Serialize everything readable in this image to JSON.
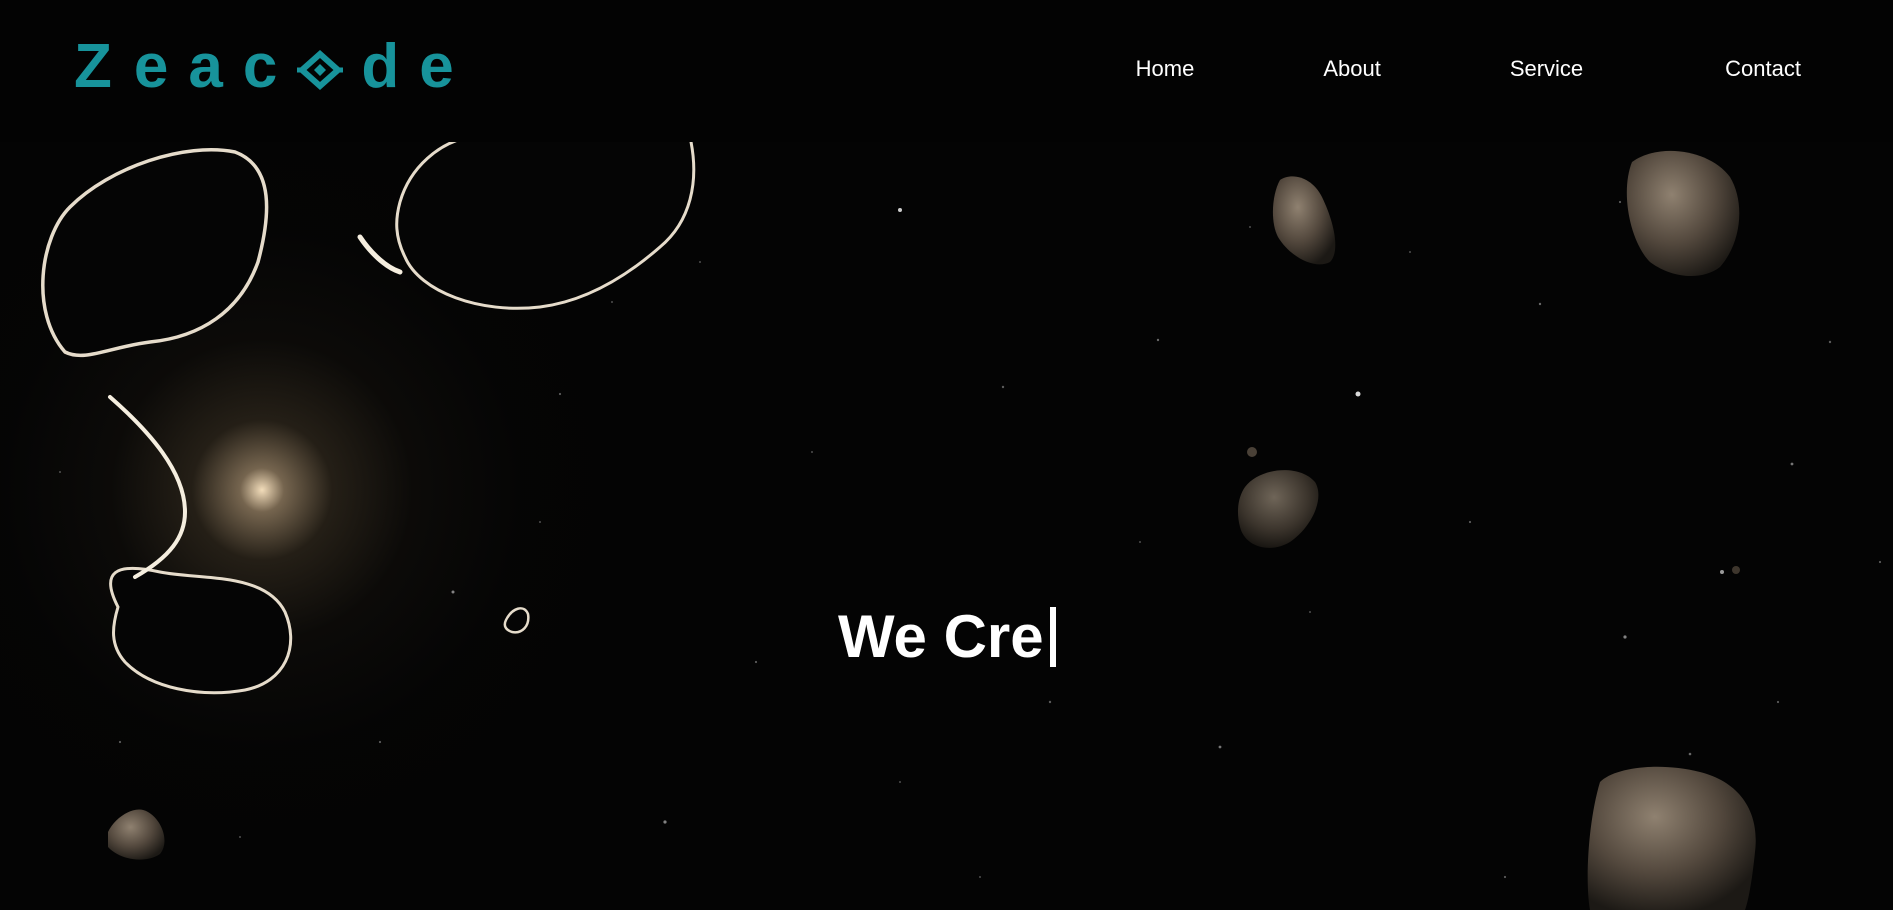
{
  "brand": {
    "logo_letters": [
      "Z",
      "e",
      "a",
      "c",
      "d",
      "e"
    ],
    "accent_color": "#17939b",
    "logo_icon": "diamond-link-icon"
  },
  "nav": {
    "items": [
      {
        "label": "Home"
      },
      {
        "label": "About"
      },
      {
        "label": "Service"
      },
      {
        "label": "Contact"
      }
    ]
  },
  "hero": {
    "headline": "We Cre",
    "background": "asteroid-field-space-image"
  }
}
